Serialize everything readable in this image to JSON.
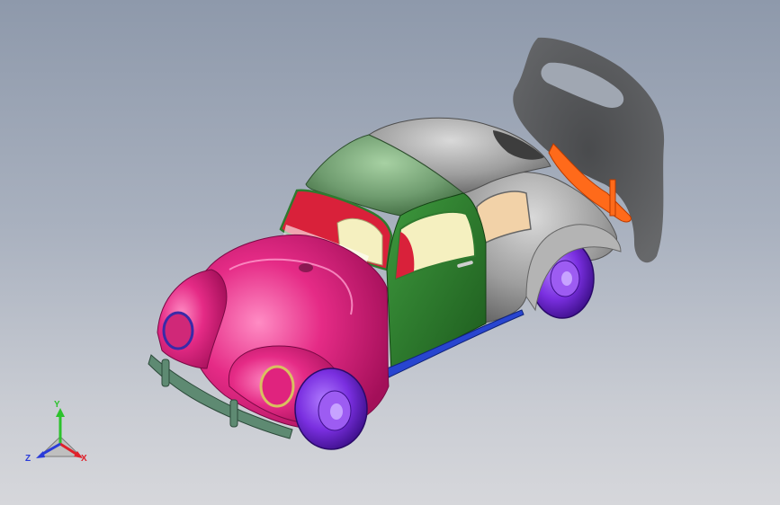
{
  "viewport": {
    "background_top": "#8e99ab",
    "background_bottom": "#d6d7db"
  },
  "model": {
    "part_colors": {
      "hood": "#e0237e",
      "fenders_front": "#e52b86",
      "roof_front": "#6f9c6f",
      "roof_rear": "#9a9a9a",
      "door": "#2f7a2f",
      "rear_body": "#8c8c8c",
      "wheels": "#7a2fe0",
      "running_board": "#2845d0",
      "bumper": "#5e8a72",
      "rear_bumper": "#ff6a1a",
      "interior_seats": "#f5f0c0",
      "interior_red": "#d9213a",
      "shadow": "#4a4a4a"
    }
  },
  "triad": {
    "y_label": "Y",
    "x_label": "X",
    "z_label": "Z",
    "y_color": "#2cc22c",
    "x_color": "#e0202a",
    "z_color": "#2a3bd9"
  }
}
